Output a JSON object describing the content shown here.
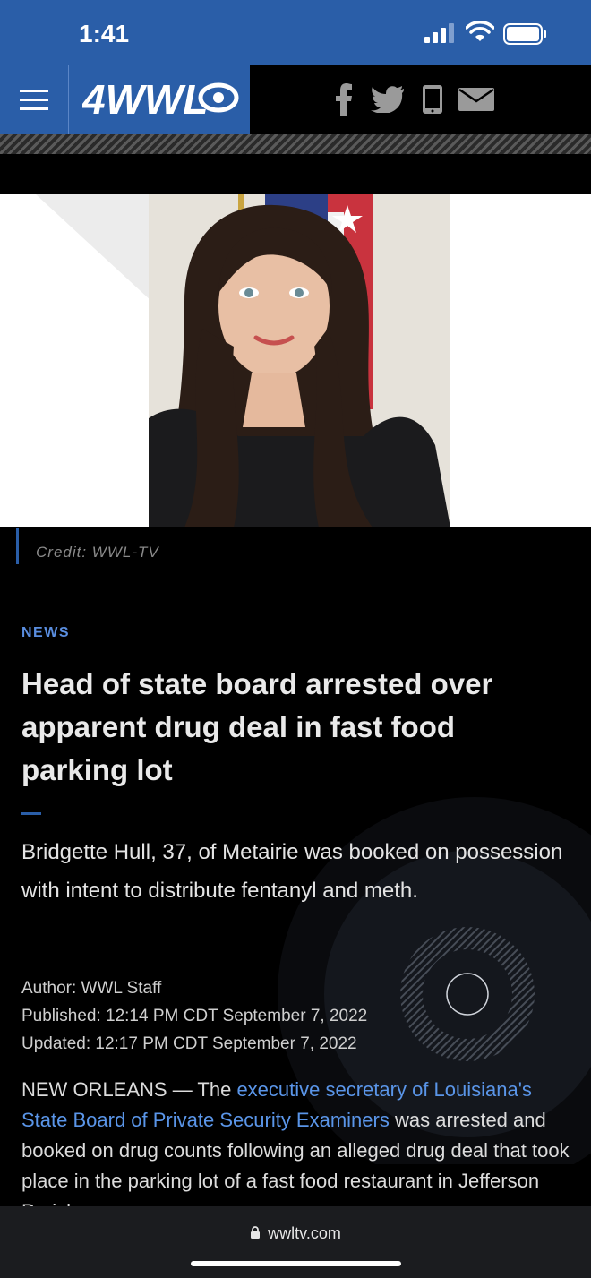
{
  "status_bar": {
    "time": "1:41"
  },
  "header": {
    "logo_text": "4WWL",
    "social": [
      "facebook-icon",
      "twitter-icon",
      "phone-icon",
      "mail-icon"
    ]
  },
  "photo": {
    "credit": "Credit: WWL-TV"
  },
  "article": {
    "category": "NEWS",
    "headline": "Head of state board arrested over apparent drug deal in fast food parking lot",
    "summary": "Bridgette Hull, 37, of Metairie was booked on possession with intent to distribute fentanyl and meth.",
    "author": "Author: WWL Staff",
    "published": "Published: 12:14 PM CDT September 7, 2022",
    "updated": "Updated: 12:17 PM CDT September 7, 2022",
    "body_lead": "NEW ORLEANS — The ",
    "body_link": "executive secretary of Louisiana's State Board of Private Security Examiners",
    "body_rest": " was arrested and booked on drug counts following an alleged drug deal that took place in the parking lot of a fast food restaurant in Jefferson Parish."
  },
  "browser": {
    "url": "wwltv.com"
  },
  "colors": {
    "brand_blue": "#2a5ea8",
    "link_blue": "#5a95e8",
    "category_blue": "#5a8ee0"
  }
}
